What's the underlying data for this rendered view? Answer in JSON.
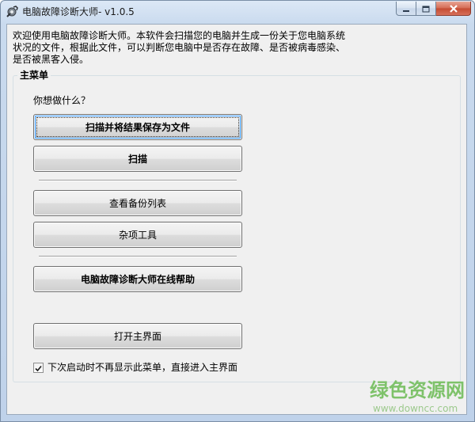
{
  "window": {
    "title": "电脑故障诊断大师- v1.0.5",
    "icon": "app-gear-icon"
  },
  "caption_buttons": {
    "minimize_icon": "minimize-icon",
    "maximize_icon": "maximize-icon",
    "close_icon": "close-icon"
  },
  "intro": {
    "text": "欢迎使用电脑故障诊断大师。本软件会扫描您的电脑并生成一份关于您电脑系统状况的文件，根据此文件，可以判断您电脑中是否存在故障、是否被病毒感染、是否被黑客入侵。"
  },
  "main_menu": {
    "group_title": "主菜单",
    "prompt": "你想做什么？",
    "buttons": {
      "scan_save": "扫描并将结果保存为文件",
      "scan": "扫描",
      "view_backup": "查看备份列表",
      "misc_tools": "杂项工具",
      "online_help": "电脑故障诊断大师在线帮助",
      "open_main": "打开主界面"
    },
    "skip_menu_checkbox": {
      "label": "下次启动时不再显示此菜单，直接进入主界面",
      "checked": true
    }
  },
  "watermark": {
    "brand": "绿色资源网",
    "url": "www.downcc.com"
  }
}
